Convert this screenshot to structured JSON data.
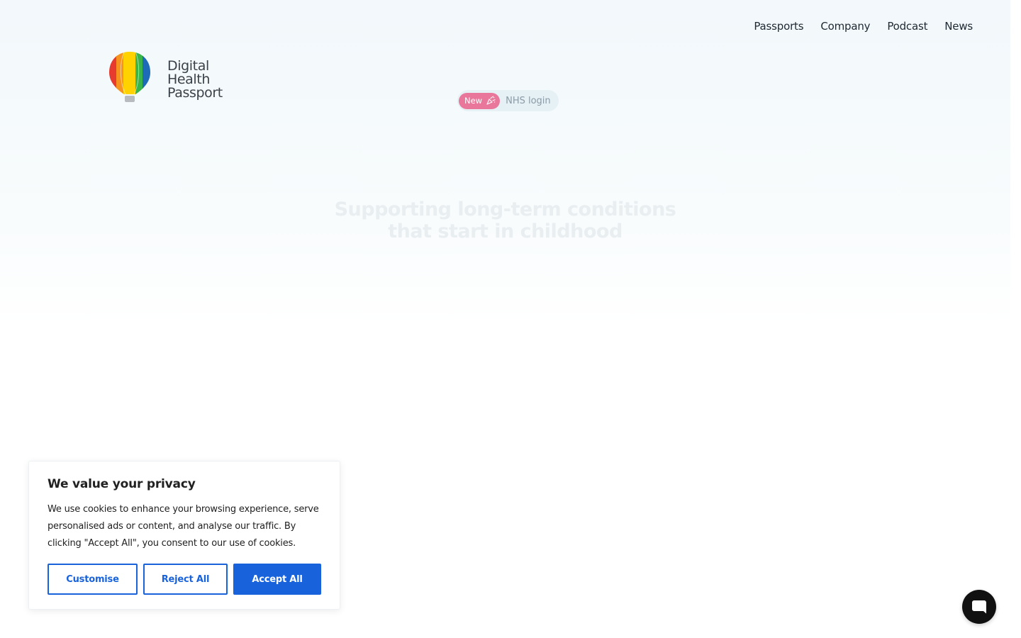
{
  "nav": {
    "items": [
      {
        "label": "Passports"
      },
      {
        "label": "Company"
      },
      {
        "label": "Podcast"
      },
      {
        "label": "News"
      }
    ]
  },
  "logo": {
    "line1": "Digital",
    "line2": "Health",
    "line3": "Passport",
    "icon": "hot-air-balloon-icon",
    "colors": [
      "#e63b2e",
      "#f7941d",
      "#ffd200",
      "#39b54a",
      "#1e6bb8"
    ]
  },
  "announcement": {
    "badge": "New",
    "badge_icon": "party-popper-icon",
    "text": "NHS login",
    "badge_color": "#e9779b"
  },
  "hero": {
    "title": "Supporting long-term conditions that start in childhood"
  },
  "cookie_banner": {
    "title": "We value your privacy",
    "body": "We use cookies to enhance your browsing experience, serve personalised ads or content, and analyse our traffic. By clicking \"Accept All\", you consent to our use of cookies.",
    "customise_label": "Customise",
    "reject_label": "Reject All",
    "accept_label": "Accept All",
    "accent_color": "#1863dc"
  },
  "chat": {
    "icon": "chat-bubble-icon"
  }
}
